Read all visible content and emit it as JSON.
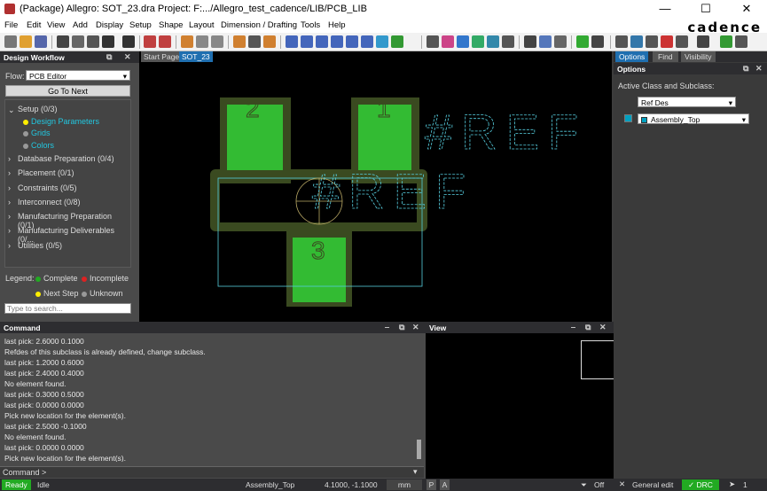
{
  "window": {
    "title": "(Package) Allegro: SOT_23.dra  Project: F:.../Allegro_test_cadence/LIB/PCB_LIB",
    "minimize": "—",
    "maximize": "☐",
    "close": "✕"
  },
  "menu": [
    "File",
    "Edit",
    "View",
    "Add",
    "Display",
    "Setup",
    "Shape",
    "Layout",
    "Dimension / Drafting",
    "Tools",
    "Help"
  ],
  "brand": "cadence",
  "workflow": {
    "title": "Design Workflow",
    "flow_label": "Flow:",
    "flow_value": "PCB Editor",
    "goto_next": "Go To Next",
    "setup": {
      "label": "Setup (0/3)",
      "items": [
        "Design Parameters",
        "Grids",
        "Colors"
      ]
    },
    "sections": [
      "Database Preparation (0/4)",
      "Placement (0/1)",
      "Constraints (0/5)",
      "Interconnect (0/8)",
      "Manufacturing Preparation (0/1)",
      "Manufacturing Deliverables (0/...",
      "Utilities (0/5)"
    ],
    "legend_label": "Legend:",
    "legend": [
      "Complete",
      "Incomplete",
      "Next Step",
      "Unknown"
    ],
    "search_placeholder": "Type to search..."
  },
  "tabs": [
    "Start Page",
    "SOT_23"
  ],
  "canvas": {
    "pad_labels": [
      "2",
      "1",
      "3"
    ],
    "ref_text": "#REF"
  },
  "options": {
    "tabs": [
      "Options",
      "Find",
      "Visibility"
    ],
    "title": "Options",
    "active_class_label": "Active Class and Subclass:",
    "class_value": "Ref Des",
    "subclass_value": "Assembly_Top",
    "subclass_color": "#00a0c0"
  },
  "command": {
    "title": "Command",
    "lines": [
      "last pick:  2.6000 0.1000",
      "Refdes of this subclass is already defined, change subclass.",
      "last pick:  1.2000 0.6000",
      "last pick:  2.4000 0.4000",
      "No element found.",
      "last pick:  0.3000 0.5000",
      "last pick:  0.0000 0.0000",
      "Pick new location for the element(s).",
      "last pick:  2.5000 -0.1000",
      "No element found.",
      "last pick:  0.0000 0.0000",
      "Pick new location for the element(s)."
    ],
    "prompt": "Command >"
  },
  "view": {
    "title": "View"
  },
  "status": {
    "ready": "Ready",
    "idle": "Idle",
    "subclass": "Assembly_Top",
    "coords": "4.1000, -1.1000",
    "units": "mm",
    "p": "P",
    "a": "A",
    "off": "Off",
    "mode": "General edit",
    "drc": "DRC",
    "count": "1"
  },
  "colors": {
    "pad": "#33bb33",
    "outline": "#55ccdd",
    "assembly": "#3a4a20"
  }
}
